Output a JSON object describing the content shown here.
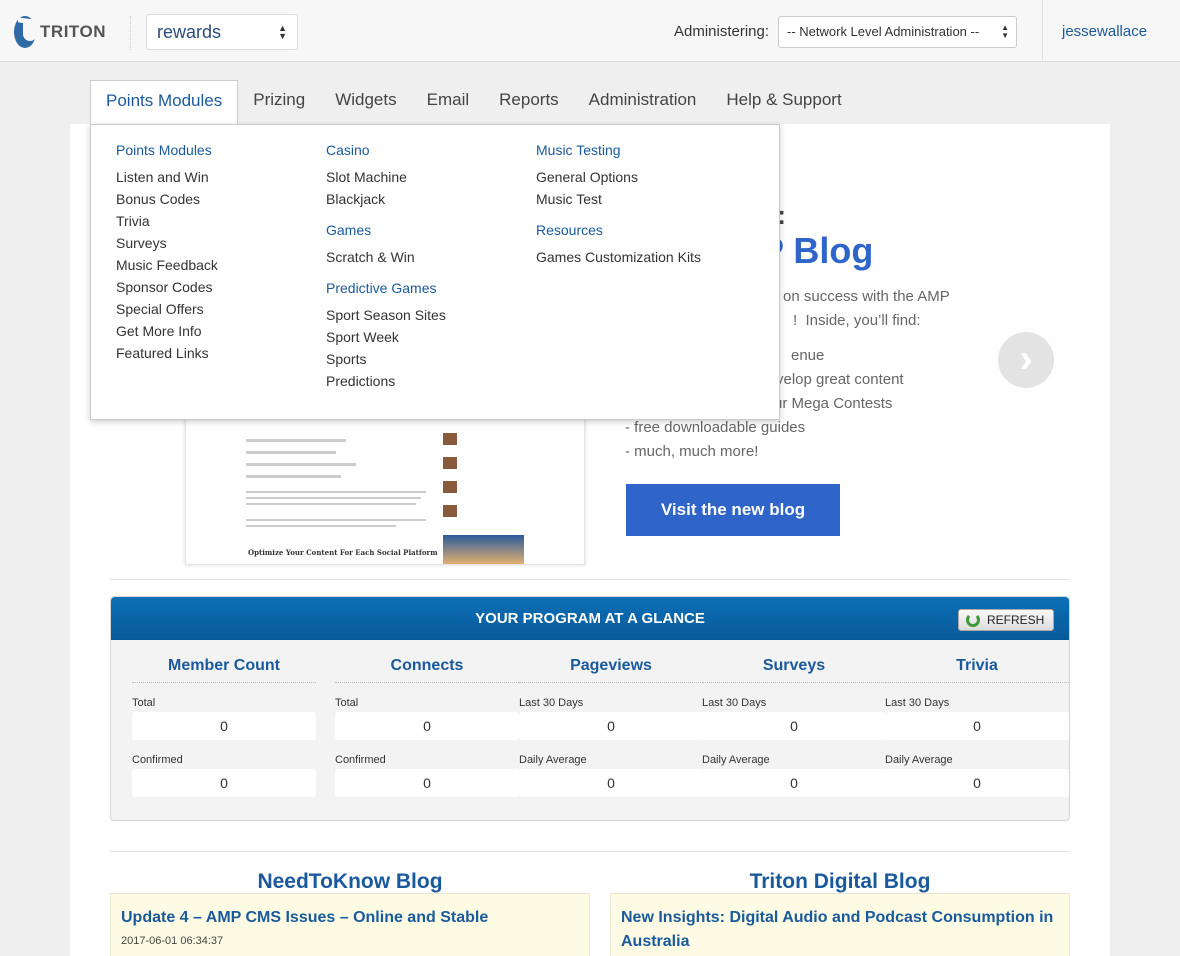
{
  "header": {
    "logo_text": "TRITON",
    "site_select_value": "rewards",
    "administering_label": "Administering:",
    "admin_select_value": "-- Network Level Administration --",
    "username": "jessewallace"
  },
  "nav": {
    "tabs": [
      {
        "label": "Points Modules"
      },
      {
        "label": "Prizing"
      },
      {
        "label": "Widgets"
      },
      {
        "label": "Email"
      },
      {
        "label": "Reports"
      },
      {
        "label": "Administration"
      },
      {
        "label": "Help & Support"
      }
    ]
  },
  "menu": {
    "col1": {
      "head": "Points Modules",
      "items": [
        "Listen and Win",
        "Bonus Codes",
        "Trivia",
        "Surveys",
        "Music Feedback",
        "Sponsor Codes",
        "Special Offers",
        "Get More Info",
        "Featured Links"
      ]
    },
    "col2": {
      "head1": "Casino",
      "items1": [
        "Slot Machine",
        "Blackjack"
      ],
      "head2": "Games",
      "items2": [
        "Scratch & Win"
      ],
      "head3": "Predictive Games",
      "items3": [
        "Sport Season Sites",
        "Sport Week",
        "Sports",
        "Predictions"
      ]
    },
    "col3": {
      "head1": "Music Testing",
      "items1": [
        "General Options",
        "Music Test"
      ],
      "head2": "Resources",
      "items2": [
        "Games Customization Kits"
      ]
    }
  },
  "banner": {
    "title_line1_visible": "l:",
    "title_line2_visible": "P Blog",
    "text_lines": [
      "on success with the AMP",
      "!  Inside, you’ll find:",
      "enue",
      "velop great content",
      "ur Mega Contests",
      "- free downloadable guides",
      "- much, much more!"
    ],
    "image_heading": "Optimize Your Content For Each Social Platform",
    "visit_button": "Visit the new blog"
  },
  "glance": {
    "title": "YOUR PROGRAM AT A GLANCE",
    "refresh_label": "REFRESH",
    "columns": [
      {
        "title": "Member Count",
        "label1": "Total",
        "value1": "0",
        "label2": "Confirmed",
        "value2": "0"
      },
      {
        "title": "Connects",
        "label1": "Total",
        "value1": "0",
        "label2": "Confirmed",
        "value2": "0"
      },
      {
        "title": "Pageviews",
        "label1": "Last 30 Days",
        "value1": "0",
        "label2": "Daily Average",
        "value2": "0"
      },
      {
        "title": "Surveys",
        "label1": "Last 30 Days",
        "value1": "0",
        "label2": "Daily Average",
        "value2": "0"
      },
      {
        "title": "Trivia",
        "label1": "Last 30 Days",
        "value1": "0",
        "label2": "Daily Average",
        "value2": "0"
      }
    ]
  },
  "blogs": {
    "left": {
      "title": "NeedToKnow Blog",
      "post": "Update 4 – AMP CMS Issues – Online and Stable",
      "date": "2017-06-01 06:34:37"
    },
    "right": {
      "title": "Triton Digital Blog",
      "post": "New Insights: Digital Audio and Podcast Consumption in Australia"
    }
  },
  "colors": {
    "accent": "#1a5a9c",
    "blog_blue": "#2f64c8",
    "glance_header": "#0d6fb5"
  }
}
